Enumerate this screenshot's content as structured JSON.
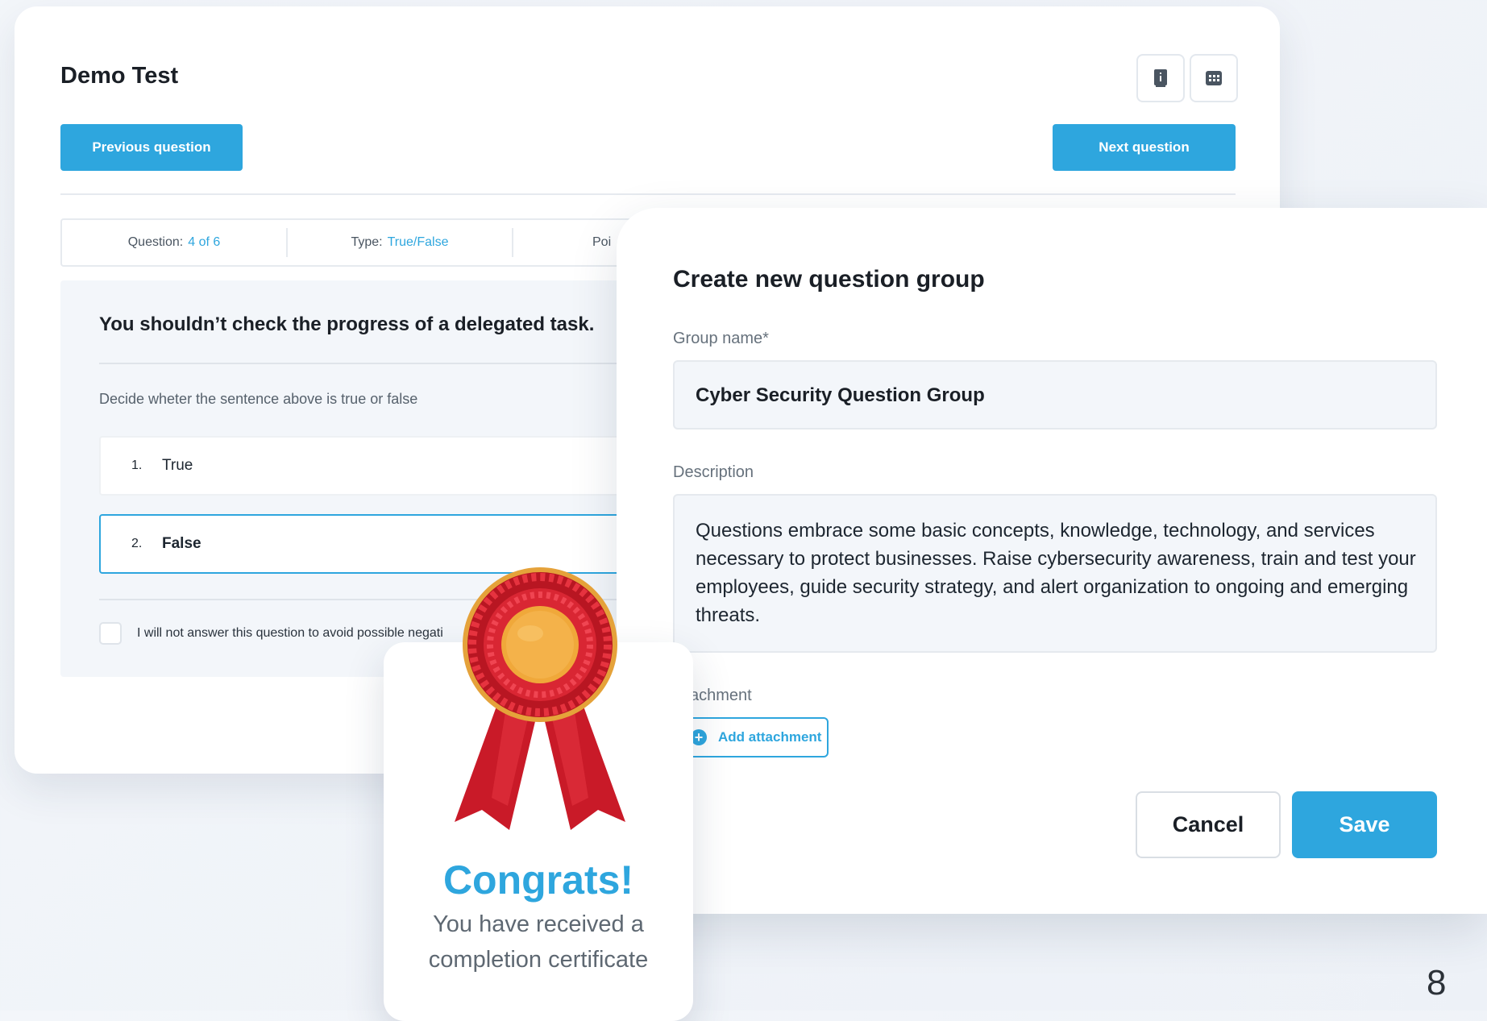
{
  "test": {
    "title": "Demo Test",
    "icons": [
      "book-icon",
      "grid-icon"
    ],
    "prev_label": "Previous question",
    "next_label": "Next question",
    "info": {
      "question_label": "Question:",
      "question_value": "4 of 6",
      "type_label": "Type:",
      "type_value": "True/False",
      "points_label": "Poi"
    },
    "question_text": "You shouldn’t check the progress of a delegated task.",
    "instruction": "Decide wheter the sentence above is true or false",
    "options": [
      {
        "num": "1.",
        "label": "True",
        "selected": false
      },
      {
        "num": "2.",
        "label": "False",
        "selected": true
      }
    ],
    "skip_text": "I will not answer this question to avoid possible negati"
  },
  "modal": {
    "title": "Create new question group",
    "group_name_label": "Group name*",
    "group_name_value": "Cyber Security Question Group",
    "description_label": "Description",
    "description_value": "Questions embrace some basic concepts, knowledge, technology, and services necessary to protect businesses. Raise cybersecurity awareness, train and test your employees, guide security strategy, and alert organization to ongoing and emerging threats.",
    "attachment_label": "achment",
    "add_attachment_label": "Add attachment",
    "cancel_label": "Cancel",
    "save_label": "Save"
  },
  "congrats": {
    "title": "Congrats!",
    "subtitle_line1": "You have received a",
    "subtitle_line2": "completion certificate",
    "icon": "award-ribbon-icon"
  },
  "page_number": "8",
  "colors": {
    "accent": "#2ea6de",
    "ribbon_red": "#d1202e",
    "medal_gold": "#f0a83a"
  }
}
